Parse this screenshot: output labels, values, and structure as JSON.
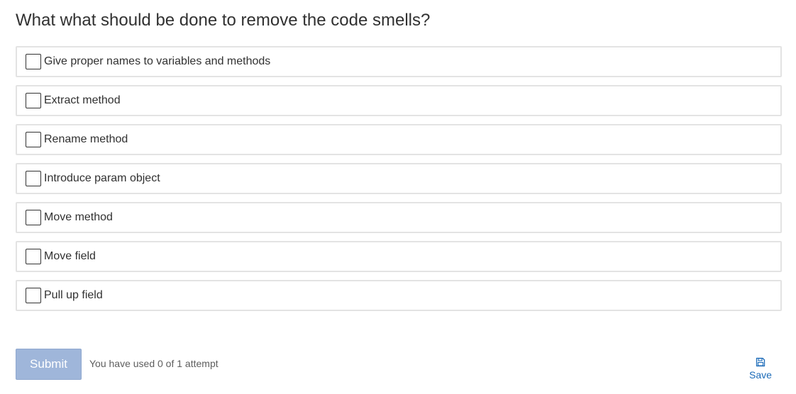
{
  "question": {
    "text": "What what should be done to remove the code smells?"
  },
  "choices": [
    {
      "label": "Give proper names to variables and methods",
      "checked": false
    },
    {
      "label": "Extract method",
      "checked": false
    },
    {
      "label": "Rename method",
      "checked": false
    },
    {
      "label": "Introduce param object",
      "checked": false
    },
    {
      "label": "Move method",
      "checked": false
    },
    {
      "label": "Move field",
      "checked": false
    },
    {
      "label": "Pull up field",
      "checked": false
    }
  ],
  "footer": {
    "submit_label": "Submit",
    "attempts_text": "You have used 0 of 1 attempt",
    "save_label": "Save",
    "save_icon": "floppy-disk-icon"
  },
  "colors": {
    "submit_bg": "#9fb6da",
    "link": "#1c6bb8",
    "choice_border": "#e3e3e3"
  }
}
